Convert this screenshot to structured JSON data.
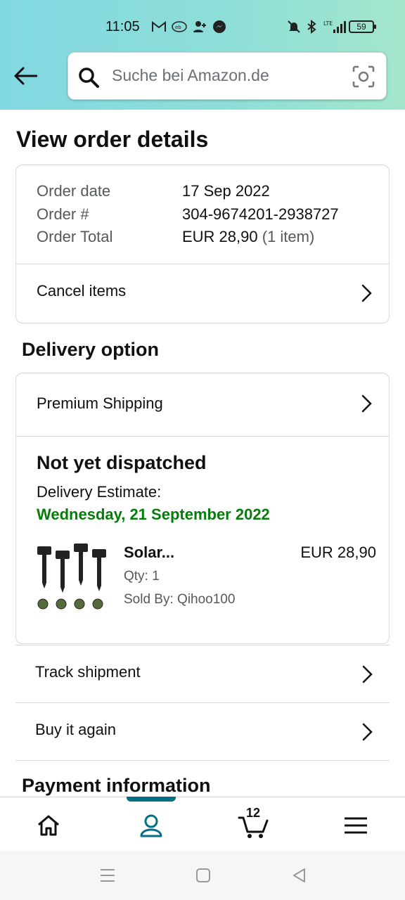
{
  "status_bar": {
    "time": "11:05",
    "network": "LTE",
    "battery": "59",
    "icons_left": [
      "gmail-icon",
      "ebay-kleinanzeigen-icon",
      "person-add-icon",
      "messenger-icon"
    ],
    "icons_right": [
      "mute-icon",
      "bluetooth-icon",
      "signal-icon"
    ]
  },
  "search": {
    "placeholder": "Suche bei Amazon.de"
  },
  "page": {
    "title": "View order details"
  },
  "order_summary": {
    "rows": [
      {
        "label": "Order date",
        "value": "17 Sep 2022"
      },
      {
        "label": "Order #",
        "value": "304-9674201-2938727"
      },
      {
        "label": "Order Total",
        "value": "EUR 28,90",
        "extra": "(1 item)"
      }
    ],
    "cancel_label": "Cancel items"
  },
  "delivery": {
    "section_title": "Delivery option",
    "shipping_option": "Premium Shipping",
    "status": "Not yet dispatched",
    "estimate_label": "Delivery Estimate:",
    "estimate_date": "Wednesday, 21 September 2022",
    "item": {
      "name": "Solar...",
      "price": "EUR 28,90",
      "qty": "Qty: 1",
      "seller": "Sold By: Qihoo100"
    }
  },
  "actions": {
    "track": "Track shipment",
    "buy_again": "Buy it again"
  },
  "payment": {
    "section_title": "Payment information"
  },
  "bottom_nav": {
    "items": [
      "home-icon",
      "account-icon",
      "cart-icon",
      "menu-icon"
    ],
    "active": "account-icon",
    "cart_count": "12"
  },
  "colors": {
    "accent": "#007185",
    "delivery_green": "#067d0b",
    "header_start": "#82d8e2",
    "header_end": "#a4e6cc"
  }
}
